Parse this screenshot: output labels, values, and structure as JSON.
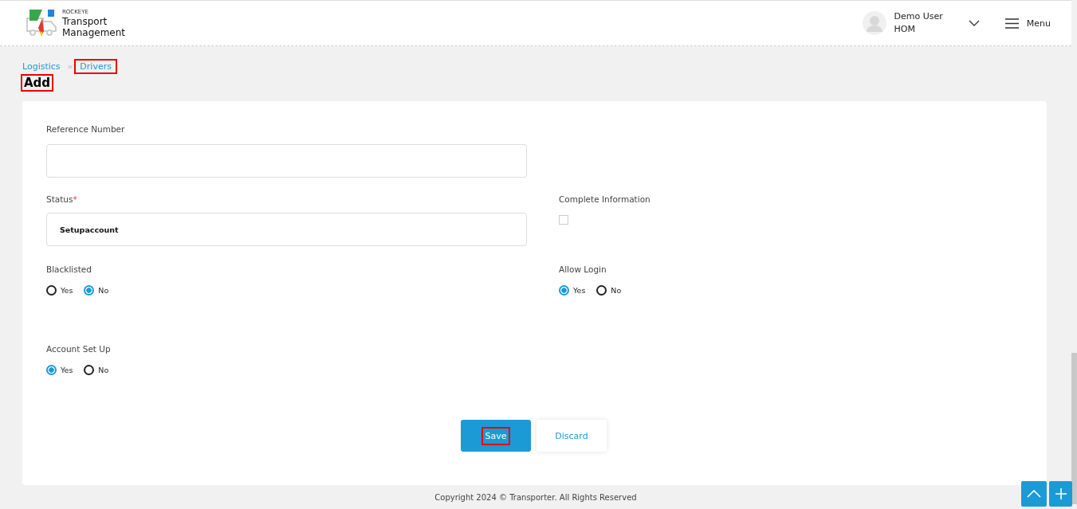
{
  "header": {
    "logo": {
      "brand": "ROCKEYE",
      "title_line_1": "Transport",
      "title_line_2": "Management"
    },
    "user": {
      "name": "Demo User",
      "role": "HOM"
    },
    "menu_label": "Menu"
  },
  "breadcrumb_separator": "»",
  "breadcrumb": [
    {
      "label": "Logistics",
      "highlighted": false
    },
    {
      "label": "Drivers",
      "highlighted": true
    }
  ],
  "page_title": {
    "text": "Add",
    "highlighted": true
  },
  "form": {
    "rows": [
      [
        {
          "kind": "text",
          "label": "Reference Number"
        }
      ],
      [
        {
          "kind": "select",
          "label": "Status",
          "required_mark": "*",
          "value": "Setupaccount"
        },
        {
          "kind": "checkbox",
          "label": "Complete Information",
          "checked": false
        }
      ],
      [
        {
          "kind": "radio",
          "label": "Blacklisted",
          "options": [
            {
              "label": "Yes",
              "selected": false
            },
            {
              "label": "No",
              "selected": true
            }
          ]
        },
        {
          "kind": "radio",
          "label": "Allow Login",
          "options": [
            {
              "label": "Yes",
              "selected": true
            },
            {
              "label": "No",
              "selected": false
            }
          ]
        }
      ],
      [
        {
          "kind": "radio",
          "label": "Account Set Up",
          "options": [
            {
              "label": "Yes",
              "selected": true
            },
            {
              "label": "No",
              "selected": false
            }
          ]
        }
      ]
    ],
    "buttons": [
      {
        "kind": "primary",
        "label": "Save",
        "highlighted": true
      },
      {
        "kind": "secondary",
        "label": "Discard",
        "highlighted": false
      }
    ]
  },
  "footer": "Copyright 2024 © Transporter. All Rights Reserved"
}
